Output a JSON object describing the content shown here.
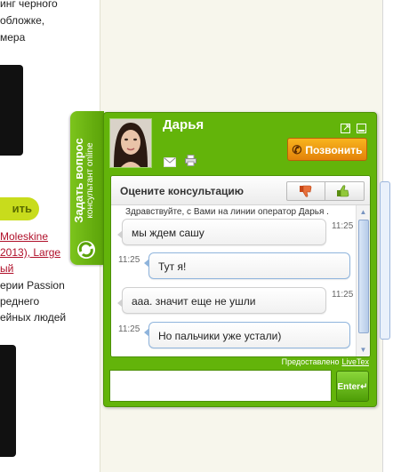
{
  "background_page": {
    "text_lines": [
      "инг черного",
      "обложке,",
      "мера"
    ],
    "button_label": "ить",
    "product_link_lines": [
      "Moleskine",
      "2013), Large",
      "ый"
    ],
    "description_lines": [
      "ерии Passion",
      "реднего",
      "ейных людей"
    ]
  },
  "side_tab": {
    "title": "Задать вопрос",
    "subtitle": "консультант online"
  },
  "chat_widget": {
    "operator_name": "Дарья",
    "call_button_label": "Позвонить",
    "rating_label": "Оцените консультацию",
    "greeting": "Здравствуйте, с Вами на линии оператор Дарья .",
    "messages": [
      {
        "text": "мы ждем сашу",
        "time": "11:25",
        "side": "operator"
      },
      {
        "text": "Тут я!",
        "time": "11:25",
        "side": "visitor"
      },
      {
        "text": "ааа. значит еще не ушли",
        "time": "11:25",
        "side": "operator"
      },
      {
        "text": "Но пальчики уже устали)",
        "time": "11:25",
        "side": "visitor"
      }
    ],
    "provided_by_label": "Предоставлено",
    "provided_by_link": "LiveTex",
    "input_value": "",
    "enter_button_label": "Enter"
  },
  "colors": {
    "widget_green": "#63b40a",
    "call_orange": "#f0a014",
    "link_red": "#b0102a",
    "accent_lime": "#c8dc1c"
  },
  "icons": [
    "avatar-photo",
    "mail-icon",
    "print-icon",
    "popout-icon",
    "minimize-icon",
    "phone-icon",
    "thumbs-down-icon",
    "thumbs-up-icon",
    "scroll-up-icon",
    "scroll-down-icon",
    "livetex-logo-icon"
  ]
}
